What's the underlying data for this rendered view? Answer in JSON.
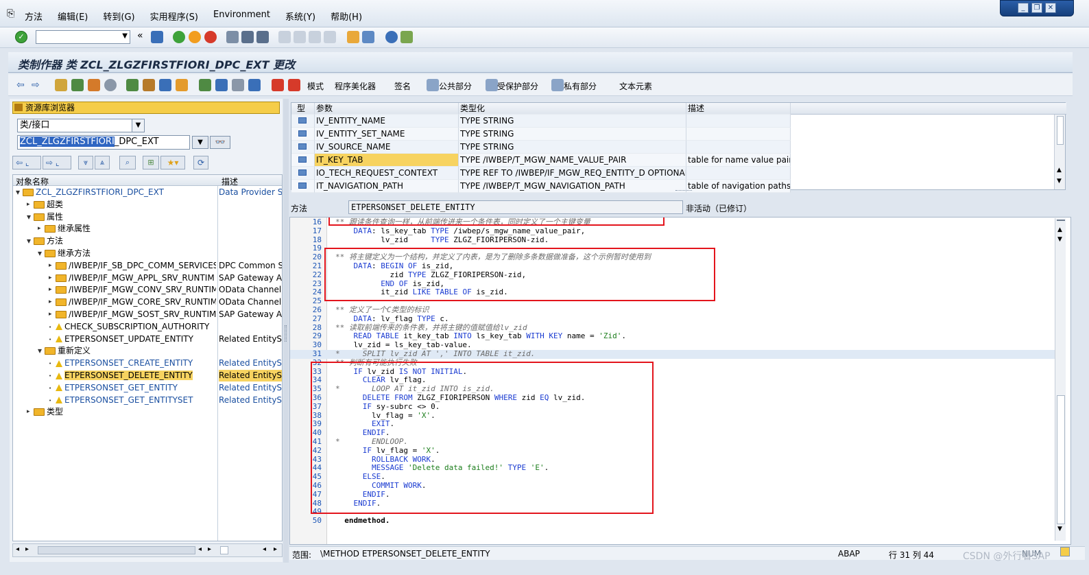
{
  "menubar": {
    "items": [
      "方法",
      "编辑(E)",
      "转到(G)",
      "实用程序(S)",
      "Environment",
      "系统(Y)",
      "帮助(H)"
    ]
  },
  "window_controls": [
    "_",
    "❐",
    "✕"
  ],
  "title": "类制作器 类 ZCL_ZLGZFIRSTFIORI_DPC_EXT 更改",
  "app_toolbar": {
    "labels": [
      "模式",
      "程序美化器",
      "签名",
      "公共部分",
      "受保护部分",
      "私有部分",
      "文本元素"
    ]
  },
  "left": {
    "repo_browser_label": "资源库浏览器",
    "objtype_value": "类/接口",
    "objname_selected": "ZCL_ZLGZFIRSTFIORI",
    "objname_rest": "_DPC_EXT",
    "tree_header": {
      "name": "对象名称",
      "desc": "描述"
    },
    "tree": [
      {
        "name": "ZCL_ZLGZFIRSTFIORI_DPC_EXT",
        "desc": "Data Provider Sec",
        "indent": 0,
        "icon": "folder",
        "arrow": "down",
        "link": true
      },
      {
        "name": "超类",
        "desc": "",
        "indent": 1,
        "icon": "folder",
        "arrow": "right"
      },
      {
        "name": "属性",
        "desc": "",
        "indent": 1,
        "icon": "folder",
        "arrow": "down"
      },
      {
        "name": "继承属性",
        "desc": "",
        "indent": 2,
        "icon": "folder",
        "arrow": "right"
      },
      {
        "name": "方法",
        "desc": "",
        "indent": 1,
        "icon": "folder",
        "arrow": "down"
      },
      {
        "name": "继承方法",
        "desc": "",
        "indent": 2,
        "icon": "folder",
        "arrow": "down"
      },
      {
        "name": "/IWBEP/IF_SB_DPC_COMM_SERVICES",
        "desc": "DPC Common Ser",
        "indent": 3,
        "icon": "folder",
        "arrow": "right"
      },
      {
        "name": "/IWBEP/IF_MGW_APPL_SRV_RUNTIM",
        "desc": "SAP Gateway Ap",
        "indent": 3,
        "icon": "folder",
        "arrow": "right"
      },
      {
        "name": "/IWBEP/IF_MGW_CONV_SRV_RUNTIM",
        "desc": "OData Channel -",
        "indent": 3,
        "icon": "folder",
        "arrow": "right"
      },
      {
        "name": "/IWBEP/IF_MGW_CORE_SRV_RUNTIM",
        "desc": "OData Channel -",
        "indent": 3,
        "icon": "folder",
        "arrow": "right"
      },
      {
        "name": "/IWBEP/IF_MGW_SOST_SRV_RUNTIM",
        "desc": "SAP Gateway Ap",
        "indent": 3,
        "icon": "folder",
        "arrow": "right"
      },
      {
        "name": "CHECK_SUBSCRIPTION_AUTHORITY",
        "desc": "",
        "indent": 3,
        "icon": "warn",
        "arrow": "dot"
      },
      {
        "name": "ETPERSONSET_UPDATE_ENTITY",
        "desc": "Related EntitySet",
        "indent": 3,
        "icon": "warn",
        "arrow": "dot"
      },
      {
        "name": "重新定义",
        "desc": "",
        "indent": 2,
        "icon": "folder",
        "arrow": "down"
      },
      {
        "name": "ETPERSONSET_CREATE_ENTITY",
        "desc": "Related EntitySet",
        "indent": 3,
        "icon": "warn",
        "arrow": "dot",
        "link": true
      },
      {
        "name": "ETPERSONSET_DELETE_ENTITY",
        "desc": "Related EntitySet",
        "indent": 3,
        "icon": "warn",
        "arrow": "dot",
        "selected": true
      },
      {
        "name": "ETPERSONSET_GET_ENTITY",
        "desc": "Related EntitySet",
        "indent": 3,
        "icon": "warn",
        "arrow": "dot",
        "link": true
      },
      {
        "name": "ETPERSONSET_GET_ENTITYSET",
        "desc": "Related EntitySet",
        "indent": 3,
        "icon": "warn",
        "arrow": "dot",
        "link": true
      },
      {
        "name": "类型",
        "desc": "",
        "indent": 1,
        "icon": "folder",
        "arrow": "right"
      }
    ]
  },
  "params": {
    "headers": [
      "型",
      "参数",
      "类型化",
      "描述"
    ],
    "rows": [
      {
        "param": "IV_ENTITY_NAME",
        "typing": "TYPE STRING",
        "desc": ""
      },
      {
        "param": "IV_ENTITY_SET_NAME",
        "typing": "TYPE STRING",
        "desc": ""
      },
      {
        "param": "IV_SOURCE_NAME",
        "typing": "TYPE STRING",
        "desc": ""
      },
      {
        "param": "IT_KEY_TAB",
        "typing": "TYPE /IWBEP/T_MGW_NAME_VALUE_PAIR",
        "desc": "table for name value pairs",
        "highlight": true
      },
      {
        "param": "IO_TECH_REQUEST_CONTEXT",
        "typing": "TYPE REF TO /IWBEP/IF_MGW_REQ_ENTITY_D OPTIONAL",
        "desc": ""
      },
      {
        "param": "IT_NAVIGATION_PATH",
        "typing": "TYPE /IWBEP/T_MGW_NAVIGATION_PATH",
        "desc": "table of navigation paths"
      }
    ]
  },
  "method": {
    "label": "方法",
    "name": "ETPERSONSET_DELETE_ENTITY",
    "status": "非活动（已修订）"
  },
  "code": [
    {
      "n": "16",
      "t": "** 跟读条件查询一样，从前端传进来一个条件表，同时定义了一个主键变量",
      "c": "cm"
    },
    {
      "n": "17",
      "t": "    DATA: ls_key_tab TYPE /iwbep/s_mgw_name_value_pair,",
      "c": "code"
    },
    {
      "n": "18",
      "t": "          lv_zid     TYPE ZLGZ_FIORIPERSON-zid.",
      "c": "code"
    },
    {
      "n": "19",
      "t": "",
      "c": "code"
    },
    {
      "n": "20",
      "t": "** 将主键定义为一个结构，并定义了内表，是为了删除多条数据做准备，这个示例暂时使用到",
      "c": "cm"
    },
    {
      "n": "21",
      "t": "    DATA: BEGIN OF is_zid,",
      "c": "code"
    },
    {
      "n": "22",
      "t": "            zid TYPE ZLGZ_FIORIPERSON-zid,",
      "c": "code"
    },
    {
      "n": "23",
      "t": "          END OF is_zid,",
      "c": "code"
    },
    {
      "n": "24",
      "t": "          it_zid LIKE TABLE OF is_zid.",
      "c": "code"
    },
    {
      "n": "25",
      "t": "",
      "c": "code"
    },
    {
      "n": "26",
      "t": "** 定义了一个C类型的标识",
      "c": "cm"
    },
    {
      "n": "27",
      "t": "    DATA: lv_flag TYPE c.",
      "c": "code"
    },
    {
      "n": "28",
      "t": "** 读取前端传来的条件表，并将主键的值赋值给lv_zid",
      "c": "cm"
    },
    {
      "n": "29",
      "t": "    READ TABLE it_key_tab INTO ls_key_tab WITH KEY name = 'Zid'.",
      "c": "code"
    },
    {
      "n": "30",
      "t": "    lv_zid = ls_key_tab-value.",
      "c": "code"
    },
    {
      "n": "31",
      "t": "*     SPLIT lv_zid AT ',' INTO TABLE it_zid.",
      "c": "cm",
      "cur": true
    },
    {
      "n": "32",
      "t": "** 判断有可能执行失败",
      "c": "cm"
    },
    {
      "n": "33",
      "t": "    IF lv_zid IS NOT INITIAL.",
      "c": "code"
    },
    {
      "n": "34",
      "t": "      CLEAR lv_flag.",
      "c": "code"
    },
    {
      "n": "35",
      "t": "*       LOOP AT it_zid INTO is_zid.",
      "c": "cm"
    },
    {
      "n": "36",
      "t": "      DELETE FROM ZLGZ_FIORIPERSON WHERE zid EQ lv_zid.",
      "c": "code"
    },
    {
      "n": "37",
      "t": "      IF sy-subrc <> 0.",
      "c": "code"
    },
    {
      "n": "38",
      "t": "        lv_flag = 'X'.",
      "c": "code"
    },
    {
      "n": "39",
      "t": "        EXIT.",
      "c": "code"
    },
    {
      "n": "40",
      "t": "      ENDIF.",
      "c": "code"
    },
    {
      "n": "41",
      "t": "*       ENDLOOP.",
      "c": "cm"
    },
    {
      "n": "42",
      "t": "      IF lv_flag = 'X'.",
      "c": "code"
    },
    {
      "n": "43",
      "t": "        ROLLBACK WORK.",
      "c": "code"
    },
    {
      "n": "44",
      "t": "        MESSAGE 'Delete data failed!' TYPE 'E'.",
      "c": "code"
    },
    {
      "n": "45",
      "t": "      ELSE.",
      "c": "code"
    },
    {
      "n": "46",
      "t": "        COMMIT WORK.",
      "c": "code"
    },
    {
      "n": "47",
      "t": "      ENDIF.",
      "c": "code"
    },
    {
      "n": "48",
      "t": "    ENDIF.",
      "c": "code"
    },
    {
      "n": "49",
      "t": "",
      "c": "code"
    },
    {
      "n": "50",
      "t": "  endmethod.",
      "c": "code"
    }
  ],
  "status": {
    "scope_label": "范围:",
    "scope_value": "\\METHOD ETPERSONSET_DELETE_ENTITY",
    "lang": "ABAP",
    "pos": "行  31 列  44",
    "mode": "NUM"
  },
  "watermark": "CSDN @外行看SAP",
  "colors": {
    "accent": "#f5cd49",
    "redbox": "#e3141c",
    "keyword": "#1a3bd1"
  }
}
